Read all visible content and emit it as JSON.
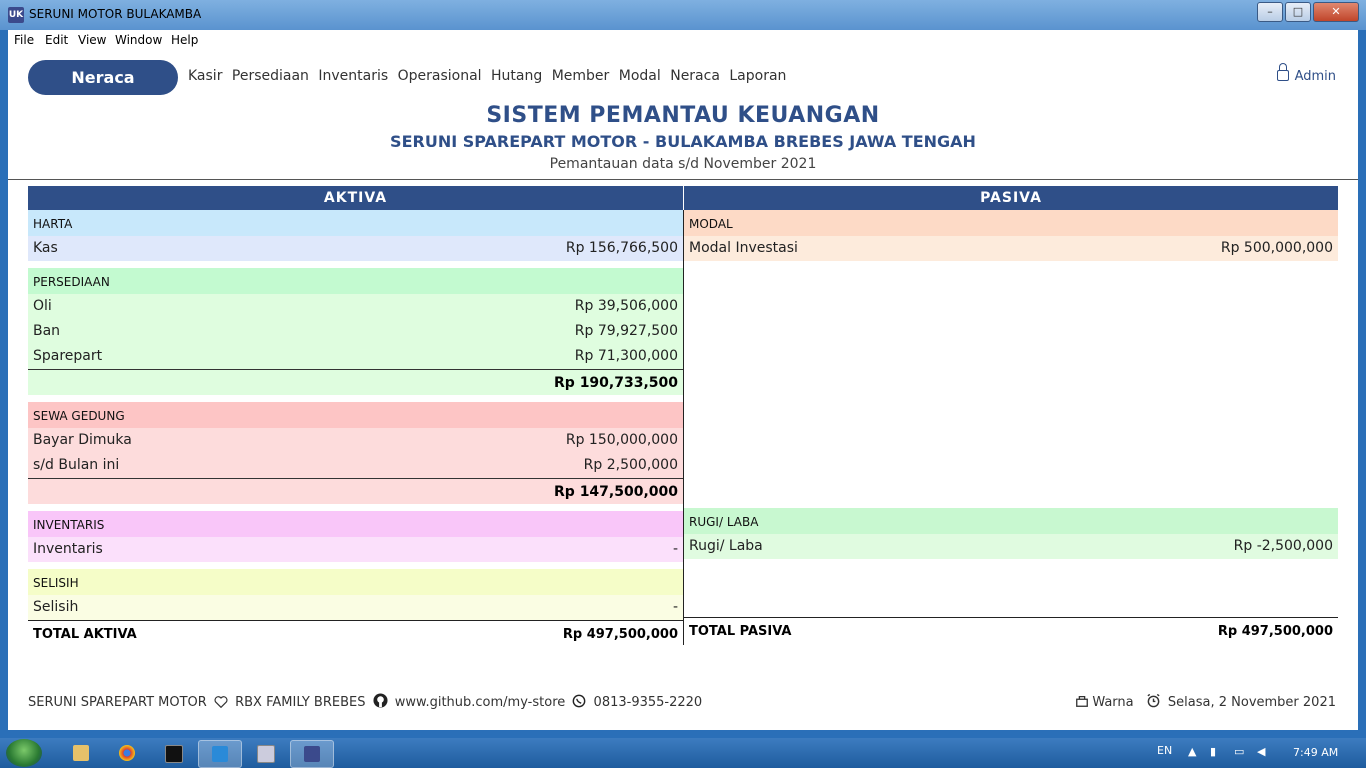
{
  "window": {
    "title": "SERUNI MOTOR BULAKAMBA",
    "app_icon": "UK",
    "min": "–",
    "max": "□",
    "close": "✕"
  },
  "menu": [
    "File",
    "Edit",
    "View",
    "Window",
    "Help"
  ],
  "nav": {
    "active": "Neraca",
    "links": [
      "Kasir",
      "Persediaan",
      "Inventaris",
      "Operasional",
      "Hutang",
      "Member",
      "Modal",
      "Neraca",
      "Laporan"
    ],
    "user": "Admin"
  },
  "header": {
    "title": "SISTEM PEMANTAU KEUANGAN",
    "subtitle": "SERUNI SPAREPART MOTOR - BULAKAMBA BREBES JAWA TENGAH",
    "period": "Pemantauan data s/d November 2021"
  },
  "aktiva": {
    "heading": "AKTIVA",
    "harta": {
      "label": "HARTA",
      "kas_label": "Kas",
      "kas_value": "Rp 156,766,500"
    },
    "persediaan": {
      "label": "PERSEDIAAN",
      "items": [
        {
          "label": "Oli",
          "value": "Rp 39,506,000"
        },
        {
          "label": "Ban",
          "value": "Rp 79,927,500"
        },
        {
          "label": "Sparepart",
          "value": "Rp 71,300,000"
        }
      ],
      "subtotal": "Rp 190,733,500"
    },
    "sewa": {
      "label": "SEWA GEDUNG",
      "items": [
        {
          "label": "Bayar Dimuka",
          "value": "Rp 150,000,000"
        },
        {
          "label": "s/d Bulan ini",
          "value": "Rp 2,500,000"
        }
      ],
      "subtotal": "Rp 147,500,000"
    },
    "inventaris": {
      "label": "INVENTARIS",
      "item_label": "Inventaris",
      "item_value": "-"
    },
    "selisih": {
      "label": "SELISIH",
      "item_label": "Selisih",
      "item_value": "-"
    },
    "total_label": "TOTAL AKTIVA",
    "total_value": "Rp 497,500,000"
  },
  "pasiva": {
    "heading": "PASIVA",
    "modal": {
      "label": "MODAL",
      "item_label": "Modal Investasi",
      "item_value": "Rp 500,000,000"
    },
    "rugilaba": {
      "label": "RUGI/ LABA",
      "item_label": "Rugi/ Laba",
      "item_value": "Rp -2,500,000"
    },
    "total_label": "TOTAL PASIVA",
    "total_value": "Rp 497,500,000"
  },
  "footer": {
    "brand": "SERUNI SPAREPART MOTOR",
    "family": "RBX FAMILY BREBES",
    "github": "www.github.com/my-store",
    "phone": "0813-9355-2220",
    "warna": "Warna",
    "date": "Selasa, 2 November 2021"
  },
  "taskbar": {
    "lang": "EN",
    "time": "7:49 AM"
  },
  "colors": {
    "primary": "#2f4f88",
    "harta_head": "#c8e8fb",
    "harta_row": "#dfe8fb",
    "persediaan_head": "#c3fad0",
    "persediaan_row": "#dffddf",
    "sewa_head": "#fdc5c5",
    "sewa_row": "#fddcdc",
    "inventaris_head": "#f9c6f9",
    "inventaris_row": "#fbe0fb",
    "selisih_head": "#f5fdc8",
    "selisih_row": "#fafde3",
    "modal_head": "#fddac6",
    "modal_row": "#fdebdc",
    "rugilaba_head": "#c8f8d0",
    "rugilaba_row": "#e0fbe0"
  }
}
